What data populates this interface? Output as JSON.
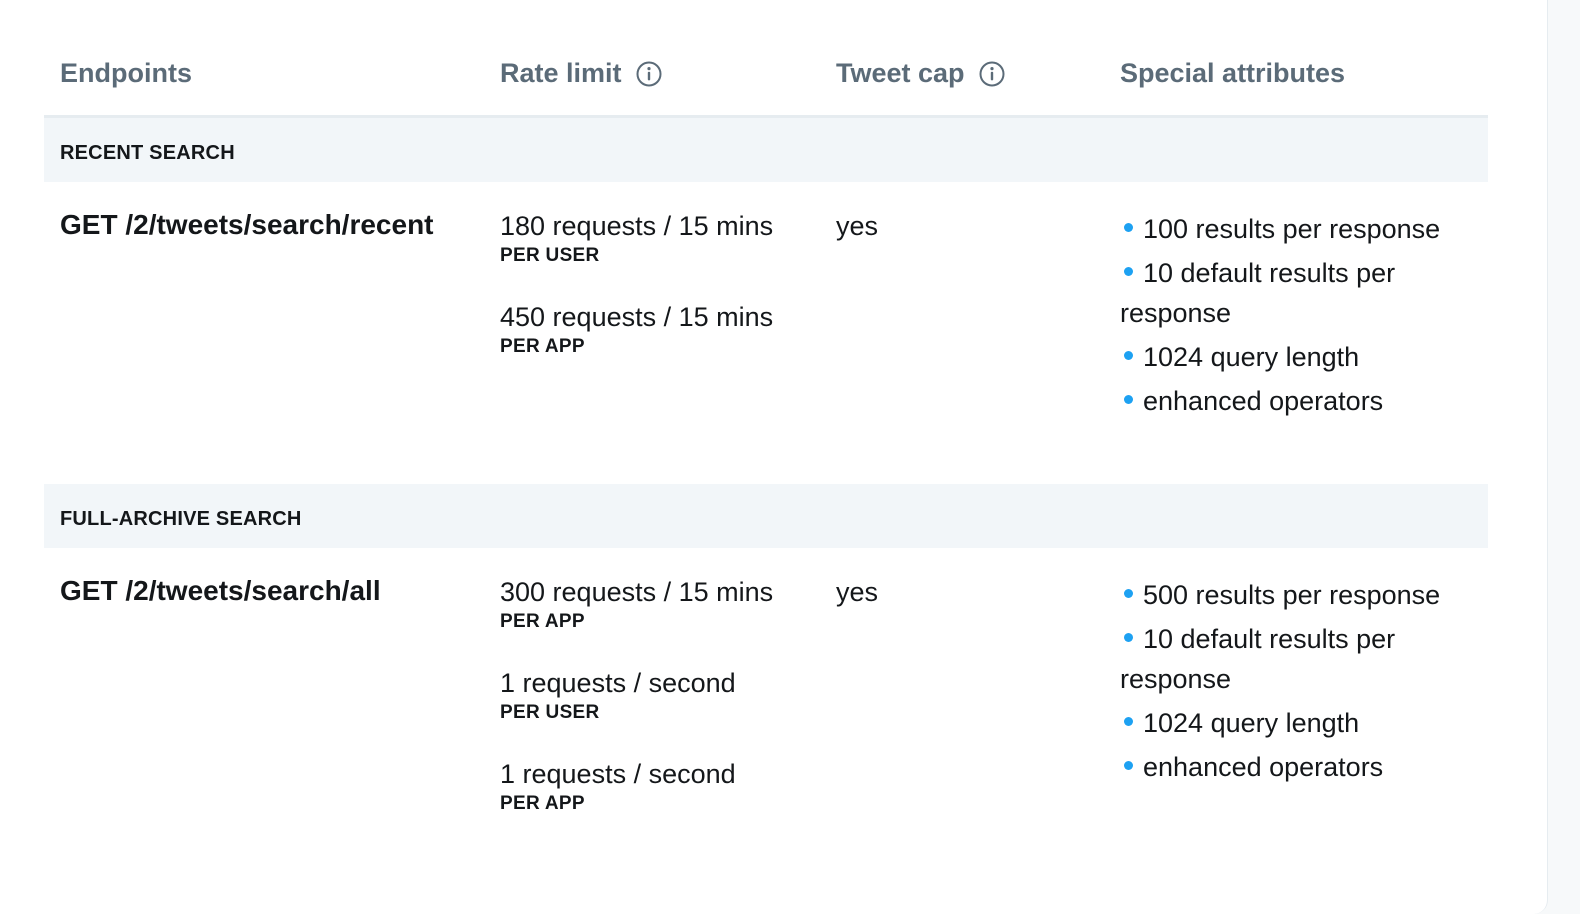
{
  "headers": {
    "endpoints": "Endpoints",
    "rate_limit": "Rate limit",
    "tweet_cap": "Tweet cap",
    "special_attributes": "Special attributes"
  },
  "icons": {
    "info": "info-circle-icon"
  },
  "colors": {
    "header_text": "#5b6b78",
    "section_bg": "#f2f6f9",
    "bullet": "#1da1f2"
  },
  "sections": [
    {
      "title": "RECENT SEARCH",
      "endpoint": "GET /2/tweets/search/recent",
      "rate_limits": [
        {
          "value": "180 requests / 15 mins",
          "scope": "PER USER"
        },
        {
          "value": "450 requests / 15 mins",
          "scope": "PER APP"
        }
      ],
      "tweet_cap": "yes",
      "attributes": [
        "100 results per response",
        "10 default results per response",
        "1024 query length",
        "enhanced operators"
      ]
    },
    {
      "title": "FULL-ARCHIVE SEARCH",
      "endpoint": "GET /2/tweets/search/all",
      "rate_limits": [
        {
          "value": "300 requests / 15 mins",
          "scope": "PER APP"
        },
        {
          "value": "1 requests / second",
          "scope": "PER USER"
        },
        {
          "value": "1 requests / second",
          "scope": "PER APP"
        }
      ],
      "tweet_cap": "yes",
      "attributes": [
        "500 results per response",
        "10 default results per response",
        "1024 query length",
        "enhanced operators"
      ]
    }
  ]
}
